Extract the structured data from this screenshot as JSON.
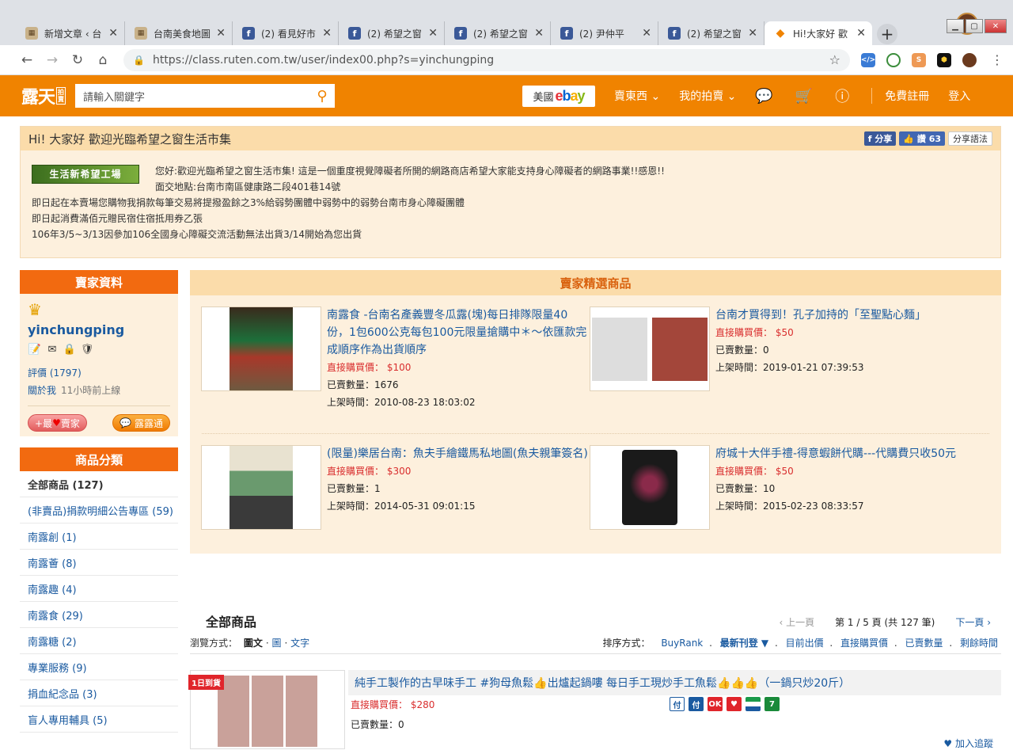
{
  "browser": {
    "tabs": [
      {
        "title": "新增文章 ‹ 台",
        "icon": "blog-icon"
      },
      {
        "title": "台南美食地圖",
        "icon": "blog-icon"
      },
      {
        "title": "(2) 看見好市",
        "icon": "facebook-icon"
      },
      {
        "title": "(2) 希望之窗",
        "icon": "facebook-icon"
      },
      {
        "title": "(2) 希望之窗",
        "icon": "facebook-icon"
      },
      {
        "title": "(2) 尹仲平",
        "icon": "facebook-icon"
      },
      {
        "title": "(2) 希望之窗",
        "icon": "facebook-icon"
      },
      {
        "title": "Hi!大家好 歡",
        "icon": "ruten-icon",
        "active": true
      }
    ],
    "url": "https://class.ruten.com.tw/user/index00.php?s=yinchungping"
  },
  "header": {
    "logo": "露天",
    "logo_tag": "拍賣",
    "search_placeholder": "請輸入關鍵字",
    "ebay_prefix": "美國",
    "ebay_logo": [
      "e",
      "b",
      "a",
      "y"
    ],
    "nav": [
      "賣東西",
      "我的拍賣",
      "免費註冊",
      "登入"
    ]
  },
  "welcome": {
    "title": "Hi! 大家好 歡迎光臨希望之窗生活市集",
    "share_label": "分享",
    "like_label": "讚",
    "like_count": "63",
    "share_lang": "分享語法",
    "banner_text": "生活新希望工場",
    "lines": [
      "您好:歡迎光臨希望之窗生活市集! 這是一個重度視覺障礙者所開的網路商店希望大家能支持身心障礙者的網路事業!!感恩!!",
      "面交地點:台南市南區健康路二段401巷14號",
      "即日起在本賣場您購物我捐款每筆交易將提撥盈餘之3%給弱勢團體中弱勢中的弱勢台南市身心障礙團體",
      "即日起消費滿佰元贈民宿住宿抵用券乙張",
      "106年3/5~3/13因參加106全國身心障礙交流活動無法出貨3/14開始為您出貨"
    ]
  },
  "seller": {
    "header": "賣家資料",
    "name": "yinchungping",
    "rating_label": "評價",
    "rating": "(1797)",
    "about": "關於我",
    "last_online": "11小時前上線",
    "fav_btn": "+最",
    "fav_btn2": "賣家",
    "chat_btn": "露露通"
  },
  "categories": {
    "header": "商品分類",
    "items": [
      "全部商品 (127)",
      "(非賣品)捐款明細公告專區 (59)",
      "南露創 (1)",
      "南露薈 (8)",
      "南露趣 (4)",
      "南露食 (29)",
      "南露糖 (2)",
      "專業服務 (9)",
      "捐血紀念品 (3)",
      "盲人專用輔具 (5)"
    ]
  },
  "featured": {
    "header": "賣家精選商品",
    "price_label": "直接購買價：",
    "sold_label": "已賣數量：",
    "time_label": "上架時間：",
    "items": [
      {
        "title": "南露食 -台南名產義豐冬瓜露(塊)每日排隊限量40份，1包600公克每包100元限量搶購中＊～依匯款完成順序作為出貨順序",
        "price": "$100",
        "sold": "1676",
        "time": "2010-08-23 18:03:02"
      },
      {
        "title": "台南才買得到！孔子加持的「至聖點心麵」",
        "price": "$50",
        "sold": "0",
        "time": "2019-01-21 07:39:53"
      },
      {
        "title": "(限量)樂居台南：魚夫手繪鐵馬私地圖(魚夫親筆簽名)",
        "price": "$300",
        "sold": "1",
        "time": "2014-05-31 09:01:15"
      },
      {
        "title": "府城十大伴手禮-得意蝦餅代購---代購費只收50元",
        "price": "$50",
        "sold": "10",
        "time": "2015-02-23 08:33:57"
      }
    ]
  },
  "all_products": {
    "header": "全部商品",
    "prev": "‹ 上一頁",
    "page_info": "第 1 / 5 頁 (共 127 筆)",
    "next": "下一頁 ›",
    "view_label": "瀏覽方式：",
    "view_modes": [
      "圖文",
      "圖",
      "文字"
    ],
    "sort_label": "排序方式：",
    "sort_options": [
      "BuyRank",
      "最新刊登 ▼",
      "目前出價",
      "直接購買價",
      "已賣數量",
      "剩餘時間"
    ],
    "ribbon": "1日到貨",
    "item": {
      "title": "純手工製作的古早味手工 #狗母魚鬆👍出爐起鍋嘍 每日手工現炒手工魚鬆👍👍👍（一鍋只炒20斤）",
      "price": "$280",
      "sold": "0"
    },
    "track": "加入追蹤"
  }
}
